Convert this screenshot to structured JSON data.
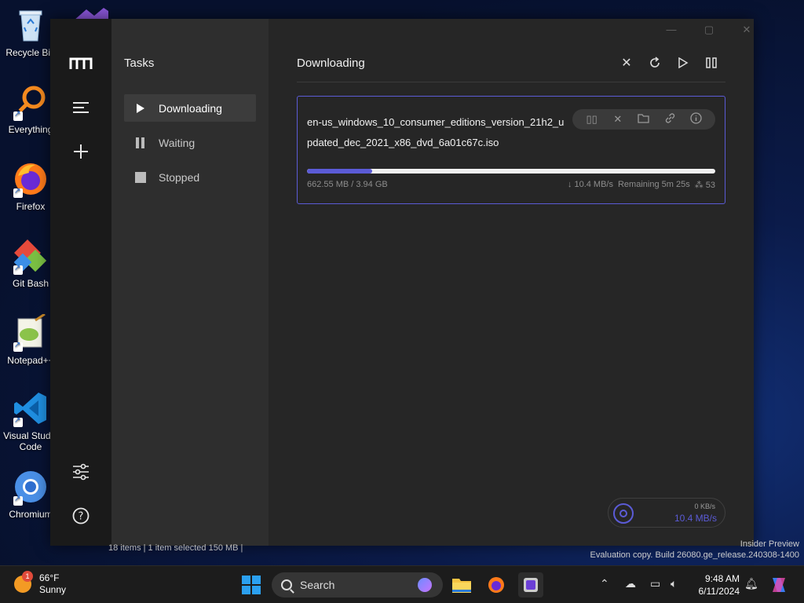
{
  "desktop": {
    "icons": [
      {
        "label": "Recycle Bin"
      },
      {
        "label": "Everything"
      },
      {
        "label": "Firefox"
      },
      {
        "label": "Git Bash"
      },
      {
        "label": "Notepad++"
      },
      {
        "label": "Visual Studio Code"
      },
      {
        "label": "Chromium"
      }
    ]
  },
  "app": {
    "sidebar": {
      "title": "Tasks",
      "items": [
        {
          "label": "Downloading",
          "icon": "play-icon",
          "active": true
        },
        {
          "label": "Waiting",
          "icon": "pause-icon",
          "active": false
        },
        {
          "label": "Stopped",
          "icon": "stop-icon",
          "active": false
        }
      ]
    },
    "main": {
      "title": "Downloading",
      "toolbar": [
        "close-icon",
        "refresh-icon",
        "play-icon",
        "pause-icon"
      ],
      "task": {
        "name": "en-us_windows_10_consumer_editions_version_21h2_updated_dec_2021_x86_dvd_6a01c67c.iso",
        "size_text": "662.55 MB / 3.94 GB",
        "speed": "↓ 10.4 MB/s",
        "remaining": "Remaining 5m 25s",
        "connections": "⁂ 53",
        "progress_percent": 16,
        "actions": [
          "pause-icon",
          "close-icon",
          "folder-icon",
          "link-icon",
          "info-icon"
        ]
      },
      "speed_widget": {
        "upload": "0 KB/s",
        "download": "10.4 MB/s"
      }
    },
    "accent_color": "#5b5bd6"
  },
  "explorer": {
    "status": "18 items  |  1 item selected  150 MB  |"
  },
  "watermark": {
    "line1": "Insider Preview",
    "line2": "Evaluation copy. Build 26080.ge_release.240308-1400"
  },
  "taskbar": {
    "weather": {
      "temp": "66°F",
      "condition": "Sunny",
      "badge": "1"
    },
    "search_placeholder": "Search",
    "time": "9:48 AM",
    "date": "6/11/2024"
  }
}
